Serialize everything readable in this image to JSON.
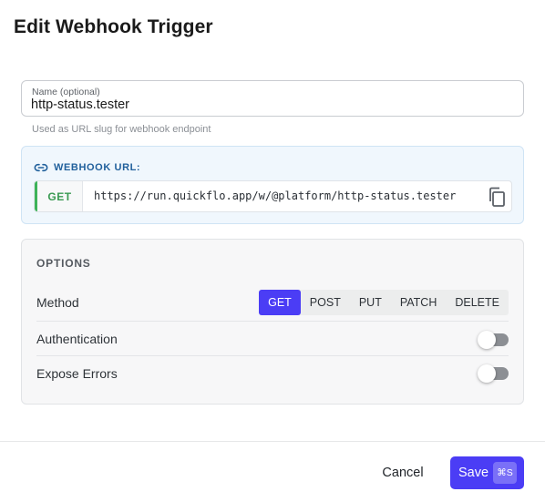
{
  "dialog": {
    "title": "Edit Webhook Trigger"
  },
  "name_field": {
    "label": "Name (optional)",
    "value": "http-status.tester",
    "helper": "Used as URL slug for webhook endpoint"
  },
  "webhook_url": {
    "heading": "WEBHOOK URL:",
    "method": "GET",
    "url": "https://run.quickflo.app/w/@platform/http-status.tester",
    "icons": {
      "heading": "link-icon",
      "copy": "copy-icon"
    }
  },
  "options": {
    "title": "OPTIONS",
    "method": {
      "label": "Method",
      "choices": [
        "GET",
        "POST",
        "PUT",
        "PATCH",
        "DELETE"
      ],
      "selected": "GET"
    },
    "authentication": {
      "label": "Authentication",
      "enabled": false
    },
    "expose_errors": {
      "label": "Expose Errors",
      "enabled": false
    }
  },
  "footer": {
    "cancel_label": "Cancel",
    "save_label": "Save",
    "save_shortcut": "⌘S"
  },
  "colors": {
    "accent": "#4b3df5",
    "get_green": "#3db35a",
    "url_box_bg": "#f0f7fd"
  }
}
